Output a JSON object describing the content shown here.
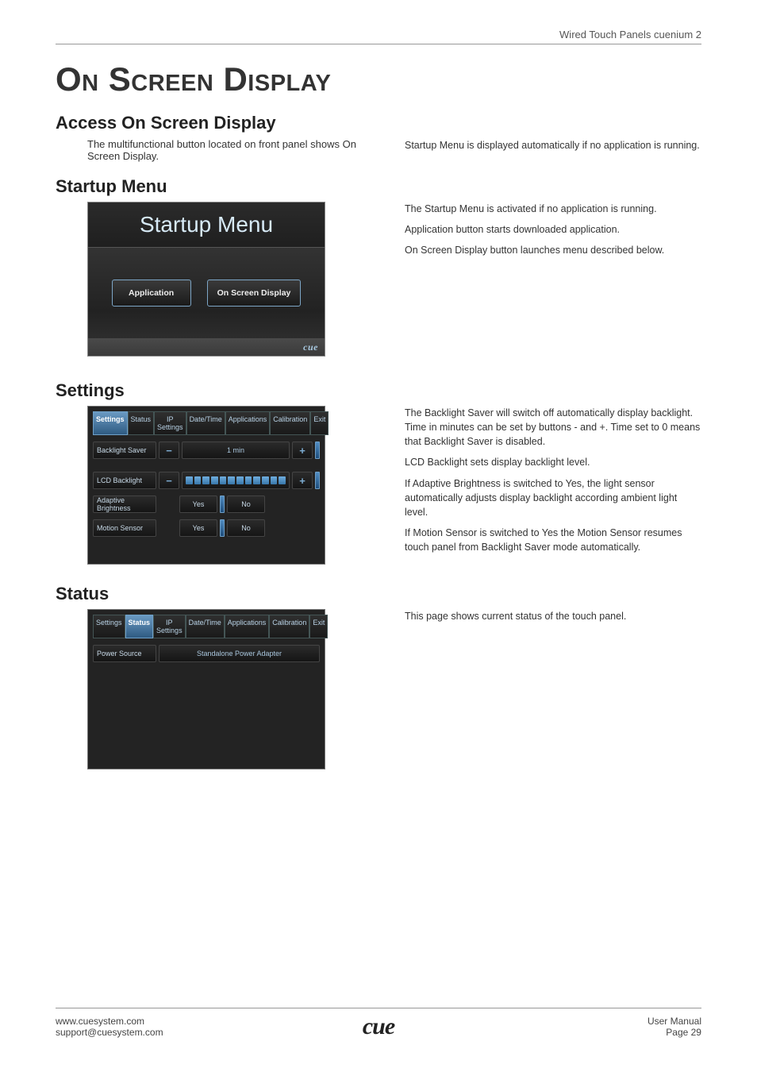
{
  "header": {
    "product": "Wired Touch Panels cuenium 2"
  },
  "title": "On Screen Display",
  "sections": {
    "access": {
      "heading": "Access On Screen Display",
      "left": "The multifunctional button located on front panel shows On Screen Display.",
      "right": "Startup Menu is displayed automatically if no application is running."
    },
    "startup": {
      "heading": "Startup Menu",
      "panel_title": "Startup Menu",
      "btn_app": "Application",
      "btn_osd": "On Screen Display",
      "brand": "cue",
      "desc": [
        "The Startup Menu is activated if no application is running.",
        "Application button starts downloaded application.",
        "On Screen Display button launches menu described below."
      ]
    },
    "settings": {
      "heading": "Settings",
      "tabs": [
        "Settings",
        "Status",
        "IP Settings",
        "Date/Time",
        "Applications",
        "Calibration",
        "Exit"
      ],
      "active_tab": 0,
      "rows": {
        "backlight_saver": {
          "label": "Backlight Saver",
          "value": "1 min"
        },
        "lcd_backlight": {
          "label": "LCD Backlight"
        },
        "adaptive": {
          "label": "Adaptive Brightness",
          "yes": "Yes",
          "no": "No"
        },
        "motion": {
          "label": "Motion Sensor",
          "yes": "Yes",
          "no": "No"
        }
      },
      "desc": [
        "The Backlight Saver will switch off automatically display backlight. Time in minutes can be set by buttons - and +. Time set to 0 means that Backlight Saver is disabled.",
        "LCD Backlight sets display backlight level.",
        "If Adaptive Brightness is switched to Yes, the light sensor automatically adjusts display backlight according ambient light level.",
        "If Motion Sensor is switched to Yes the Motion Sensor resumes touch panel from Backlight Saver mode automatically."
      ]
    },
    "status": {
      "heading": "Status",
      "tabs": [
        "Settings",
        "Status",
        "IP Settings",
        "Date/Time",
        "Applications",
        "Calibration",
        "Exit"
      ],
      "active_tab": 1,
      "row": {
        "label": "Power Source",
        "value": "Standalone Power Adapter"
      },
      "desc": "This page shows current status of the touch panel."
    }
  },
  "footer": {
    "site": "www.cuesystem.com",
    "email": "support@cuesystem.com",
    "logo": "cue",
    "manual": "User Manual",
    "page": "Page 29"
  }
}
